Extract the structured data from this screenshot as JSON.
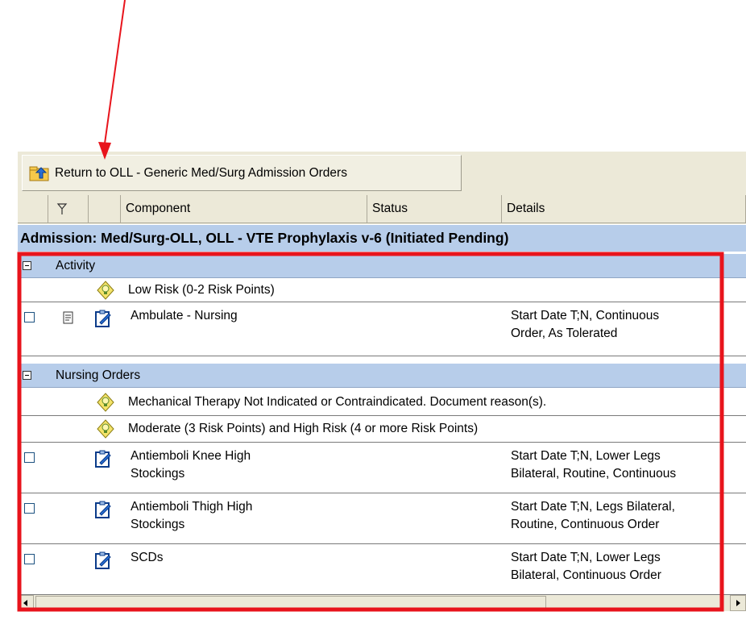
{
  "toolbar": {
    "return_label": "Return to OLL - Generic Med/Surg Admission Orders"
  },
  "columns": {
    "component": "Component",
    "status": "Status",
    "details": "Details"
  },
  "plan": {
    "title": "Admission: Med/Surg-OLL, OLL - VTE Prophylaxis v-6 (Initiated Pending)"
  },
  "sections": [
    {
      "name": "Activity",
      "items": [
        {
          "type": "note",
          "component": "Low Risk (0-2 Risk Points)"
        },
        {
          "type": "order",
          "component": "Ambulate - Nursing",
          "component_line2": "",
          "details": "Start Date T;N, Continuous",
          "details_line2": "Order, As Tolerated"
        }
      ]
    },
    {
      "name": "Nursing Orders",
      "items": [
        {
          "type": "note",
          "component": "Mechanical Therapy Not Indicated or Contraindicated. Document reason(s)."
        },
        {
          "type": "note",
          "component": "Moderate (3 Risk Points) and High Risk (4 or more Risk Points)"
        },
        {
          "type": "order",
          "component": "Antiemboli Knee High",
          "component_line2": "Stockings",
          "details": "Start Date T;N, Lower Legs",
          "details_line2": "Bilateral, Routine, Continuous"
        },
        {
          "type": "order",
          "component": "Antiemboli Thigh High",
          "component_line2": "Stockings",
          "details": "Start Date T;N, Legs Bilateral,",
          "details_line2": "Routine, Continuous Order"
        },
        {
          "type": "order",
          "component": "SCDs",
          "component_line2": "",
          "details": "Start Date T;N, Lower Legs",
          "details_line2": "Bilateral, Continuous Order"
        }
      ]
    }
  ],
  "icons": {
    "return": "return-up-folder-icon",
    "filter": "filter-flag-icon",
    "note": "note-lightbulb-icon",
    "order": "order-clipboard-icon",
    "doc": "document-icon",
    "expand": "collapse-minus-icon"
  },
  "colors": {
    "band": "#b7cdea",
    "toolbar": "#ece9d8",
    "annotation": "#e8141c"
  }
}
